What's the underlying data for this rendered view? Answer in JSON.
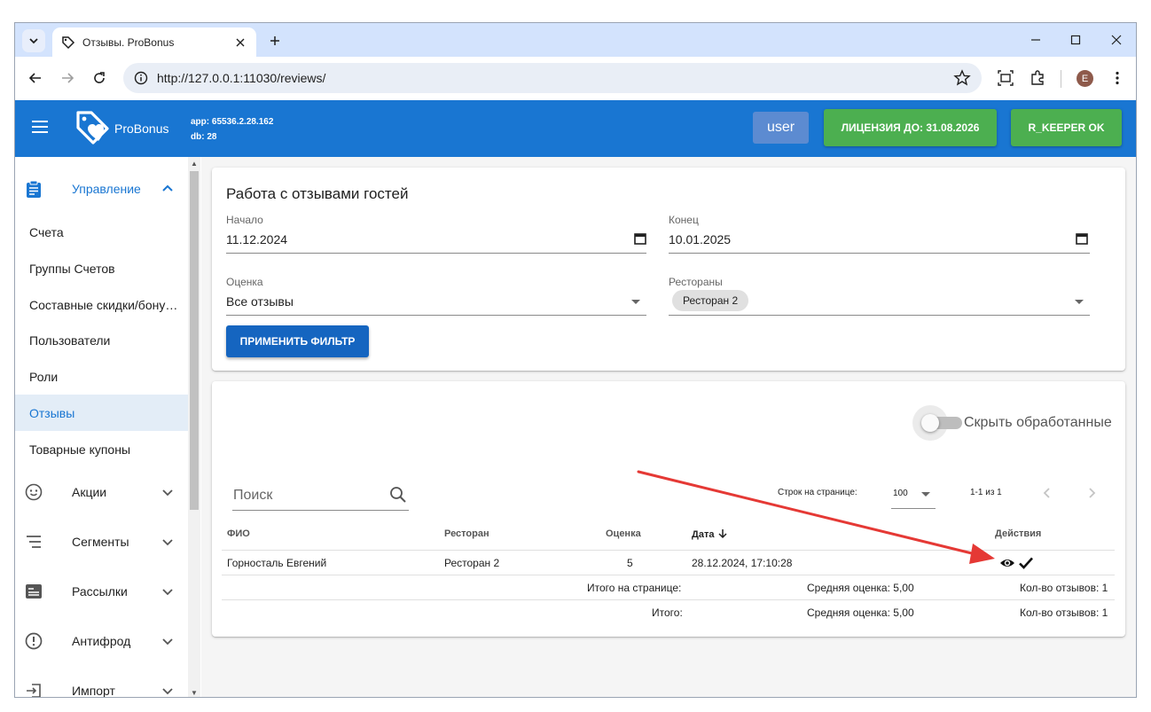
{
  "browser": {
    "tab_title": "Отзывы. ProBonus",
    "url": "http://127.0.0.1:11030/reviews/",
    "profile_initial": "E"
  },
  "header": {
    "logo_text": "ProBonus",
    "app_version": "app: 65536.2.28.162",
    "db": "db: 28",
    "user_label": "user",
    "license_label": "ЛИЦЕНЗИЯ ДО: 31.08.2026",
    "rkeeper_label": "R_KEEPER OK",
    "colors": {
      "appbar": "#1976d2",
      "success": "#4caf50",
      "user_btn": "#5c8bd1"
    }
  },
  "sidebar": {
    "groups": [
      {
        "label": "Управление",
        "icon": "clipboard-icon",
        "expanded": true
      },
      {
        "label": "Акции",
        "icon": "smile-icon"
      },
      {
        "label": "Сегменты",
        "icon": "segments-icon"
      },
      {
        "label": "Рассылки",
        "icon": "mailing-icon"
      },
      {
        "label": "Антифрод",
        "icon": "alert-circle-icon"
      },
      {
        "label": "Импорт",
        "icon": "import-icon"
      }
    ],
    "items": [
      "Счета",
      "Группы Счетов",
      "Составные скидки/бону…",
      "Пользователи",
      "Роли",
      "Отзывы",
      "Товарные купоны"
    ],
    "active_item": "Отзывы"
  },
  "filter": {
    "title": "Работа с отзывами гостей",
    "start_label": "Начало",
    "start_value": "11.12.2024",
    "end_label": "Конец",
    "end_value": "10.01.2025",
    "rating_label": "Оценка",
    "rating_value": "Все отзывы",
    "restaurants_label": "Рестораны",
    "restaurant_chip": "Ресторан 2",
    "apply_label": "ПРИМЕНИТЬ ФИЛЬТР"
  },
  "table": {
    "hide_processed_label": "Скрыть обработанные",
    "search_placeholder": "Поиск",
    "rows_per_page_label": "Строк на странице:",
    "rows_per_page_value": "100",
    "range_label": "1-1 из 1",
    "headers": {
      "name": "ФИО",
      "restaurant": "Ресторан",
      "rating": "Оценка",
      "date": "Дата",
      "actions": "Действия"
    },
    "rows": [
      {
        "name": "Горносталь Евгений",
        "restaurant": "Ресторан 2",
        "rating": "5",
        "date": "28.12.2024, 17:10:28"
      }
    ],
    "page_total_label": "Итого на странице:",
    "page_avg": "Средняя оценка: 5,00",
    "page_count": "Кол-во отзывов: 1",
    "total_label": "Итого:",
    "total_avg": "Средняя оценка: 5,00",
    "total_count": "Кол-во отзывов: 1"
  },
  "annotation": {
    "arrow_color": "#e53935"
  }
}
